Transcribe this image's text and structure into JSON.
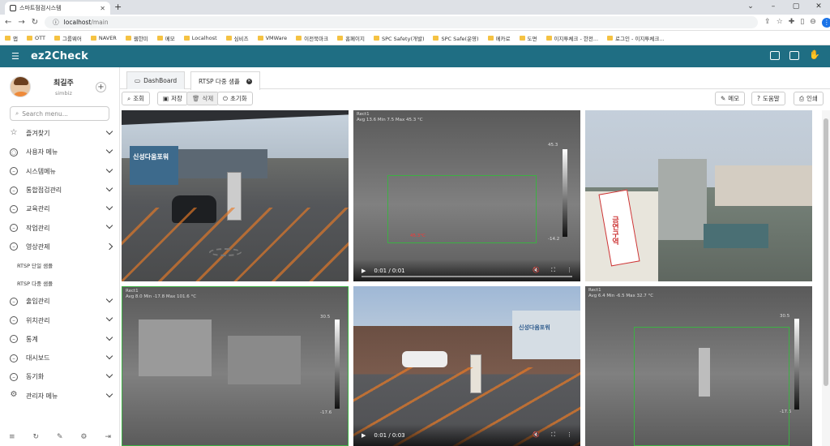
{
  "browser": {
    "tab_title": "스마트점검시스템",
    "url_host": "localhost",
    "url_path": "/main",
    "bookmarks": [
      "앱",
      "OTT",
      "그룹웨어",
      "NAVER",
      "웹한미",
      "메모",
      "Localhost",
      "심비즈",
      "VMWare",
      "이전북마크",
      "홈페이지",
      "SPC Safety(개발)",
      "SPC Safe(운영)",
      "메카로",
      "도면",
      "이지투체크 - 한전...",
      "로그인 - 이지투체크..."
    ]
  },
  "app": {
    "logo": "ez2Check"
  },
  "user": {
    "name": "최길주",
    "org": "simbiz"
  },
  "sidebar": {
    "search_placeholder": "Search menu...",
    "items": [
      {
        "label": "즐겨찾기",
        "icon": "star-icon",
        "expanded": false
      },
      {
        "label": "사용자 메뉴",
        "icon": "user-icon",
        "expanded": false
      },
      {
        "label": "시스템메뉴",
        "icon": "circle-minus-icon",
        "expanded": false
      },
      {
        "label": "통합점검관리",
        "icon": "circle-minus-icon",
        "expanded": false
      },
      {
        "label": "교육관리",
        "icon": "circle-minus-icon",
        "expanded": false
      },
      {
        "label": "작업관리",
        "icon": "circle-minus-icon",
        "expanded": false
      },
      {
        "label": "영상관제",
        "icon": "circle-minus-icon",
        "expanded": true
      },
      {
        "label": "출입관리",
        "icon": "circle-minus-icon",
        "expanded": false
      },
      {
        "label": "위치관리",
        "icon": "circle-minus-icon",
        "expanded": false
      },
      {
        "label": "통계",
        "icon": "circle-minus-icon",
        "expanded": false
      },
      {
        "label": "대시보드",
        "icon": "circle-minus-icon",
        "expanded": false
      },
      {
        "label": "동기화",
        "icon": "circle-minus-icon",
        "expanded": false
      },
      {
        "label": "관리자 메뉴",
        "icon": "gear-icon",
        "expanded": false
      }
    ],
    "subitems": [
      "RTSP 단일 샘플",
      "RTSP 다중 샘플"
    ]
  },
  "tabs": [
    {
      "label": "DashBoard",
      "active": false
    },
    {
      "label": "RTSP 다중 샘플",
      "active": true
    }
  ],
  "toolbar": {
    "search": "조회",
    "save": "저장",
    "delete": "삭제",
    "reset": "초기화",
    "memo": "메모",
    "help": "도움말",
    "print": "인쇄"
  },
  "videos": [
    {
      "kind": "rgb",
      "sign": "신성다움포워",
      "time": ""
    },
    {
      "kind": "thermal",
      "header": "Rect1",
      "stats": "Avg 13.6 Min 7.5 Max 45.3 °C",
      "scale_top": "45.3",
      "scale_bottom": "-14.2",
      "box_label": "45.3°C",
      "time": "0:01 / 0:01"
    },
    {
      "kind": "rgb",
      "sign": "금연구역",
      "time": ""
    },
    {
      "kind": "thermal",
      "header": "Rect1",
      "stats": "Avg 8.0 Min -17.8 Max 101.6 °C",
      "scale_top": "30.5",
      "scale_bottom": "-17.6",
      "box_label": "",
      "time": ""
    },
    {
      "kind": "rgb",
      "sign": "신성다움포워",
      "time": "0:01 / 0:03"
    },
    {
      "kind": "thermal",
      "header": "Rect1",
      "stats": "Avg 6.4 Min -6.5 Max 32.7 °C",
      "scale_top": "30.5",
      "scale_bottom": "-17.6",
      "box_label": "",
      "time": ""
    }
  ],
  "colors": {
    "appbar": "#1f6e83",
    "detect_box": "#3cb043"
  }
}
